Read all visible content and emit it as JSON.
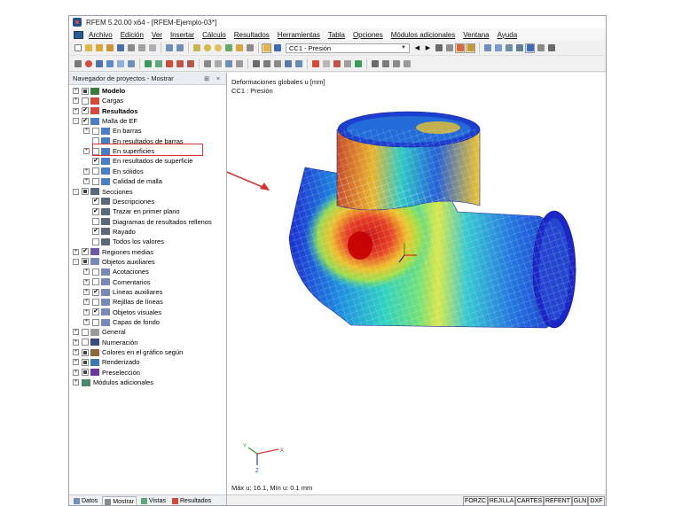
{
  "window": {
    "title": "RFEM 5.20.00 x64 - [RFEM-Ejemplo-03*]"
  },
  "menu": [
    "Archivo",
    "Edición",
    "Ver",
    "Insertar",
    "Cálculo",
    "Resultados",
    "Herramientas",
    "Tabla",
    "Opciones",
    "Módulos adicionales",
    "Ventana",
    "Ayuda"
  ],
  "toolbar": {
    "load_case": "CC1 - Presión"
  },
  "navigator": {
    "title": "Navegador de proyectos - Mostrar",
    "controls": "⊞ ×",
    "items": [
      {
        "label": "Modelo",
        "checked": "mixed",
        "expanded": "+",
        "bold": true,
        "icon": "model-icon"
      },
      {
        "label": "Cargas",
        "checked": "no",
        "expanded": "+",
        "icon": "loads-icon"
      },
      {
        "label": "Resultados",
        "checked": "yes",
        "expanded": "+",
        "bold": true,
        "icon": "results-icon"
      },
      {
        "label": "Malla de EF",
        "checked": "yes",
        "expanded": "-",
        "icon": "mesh-icon"
      },
      {
        "label": "En barras",
        "checked": "no",
        "expanded": "+",
        "icon": "mesh-icon"
      },
      {
        "label": "En resultados de barras",
        "checked": "no",
        "expanded": "",
        "icon": "mesh-icon"
      },
      {
        "label": "En superficies",
        "checked": "no",
        "expanded": "+",
        "icon": "mesh-icon"
      },
      {
        "label": "En resultados de superficie",
        "checked": "yes",
        "expanded": "",
        "icon": "mesh-icon"
      },
      {
        "label": "En sólidos",
        "checked": "no",
        "expanded": "+",
        "icon": "mesh-icon"
      },
      {
        "label": "Calidad de malla",
        "checked": "no",
        "expanded": "+",
        "icon": "mesh-icon"
      },
      {
        "label": "Secciones",
        "checked": "mixed",
        "expanded": "-",
        "icon": "sections-icon"
      },
      {
        "label": "Descripciones",
        "checked": "yes",
        "expanded": "",
        "icon": "sections-icon"
      },
      {
        "label": "Trazar en primer plano",
        "checked": "yes",
        "expanded": "",
        "icon": "sections-icon"
      },
      {
        "label": "Diagramas de resultados rellenos",
        "checked": "no",
        "expanded": "",
        "icon": "sections-icon"
      },
      {
        "label": "Rayado",
        "checked": "yes",
        "expanded": "",
        "icon": "sections-icon"
      },
      {
        "label": "Todos los valores",
        "checked": "no",
        "expanded": "",
        "icon": "sections-icon"
      },
      {
        "label": "Regiones medias",
        "checked": "yes",
        "expanded": "+",
        "icon": "regions-icon"
      },
      {
        "label": "Objetos auxiliares",
        "checked": "mixed",
        "expanded": "-",
        "icon": "aux-icon"
      },
      {
        "label": "Acotaciones",
        "checked": "no",
        "expanded": "+",
        "icon": "aux-icon"
      },
      {
        "label": "Comentarios",
        "checked": "no",
        "expanded": "+",
        "icon": "aux-icon"
      },
      {
        "label": "Líneas auxiliares",
        "checked": "yes",
        "expanded": "+",
        "icon": "aux-icon"
      },
      {
        "label": "Rejillas de líneas",
        "checked": "no",
        "expanded": "+",
        "icon": "aux-icon"
      },
      {
        "label": "Objetos visuales",
        "checked": "yes",
        "expanded": "+",
        "icon": "aux-icon"
      },
      {
        "label": "Capas de fondo",
        "checked": "no",
        "expanded": "+",
        "icon": "aux-icon"
      },
      {
        "label": "General",
        "checked": "no",
        "expanded": "+",
        "icon": "general-icon"
      },
      {
        "label": "Numeración",
        "checked": "no",
        "expanded": "+",
        "icon": "numbering-icon"
      },
      {
        "label": "Colores en el gráfico según",
        "checked": "mixed",
        "expanded": "+",
        "icon": "colors-icon"
      },
      {
        "label": "Renderizado",
        "checked": "mixed",
        "expanded": "+",
        "icon": "render-icon"
      },
      {
        "label": "Preselección",
        "checked": "mixed",
        "expanded": "+",
        "icon": "preselect-icon"
      },
      {
        "label": "Módulos adicionales",
        "checked": "",
        "expanded": "+",
        "icon": "addons-icon"
      }
    ],
    "tabs": [
      "Datos",
      "Mostrar",
      "Vistas",
      "Resultados"
    ]
  },
  "view": {
    "label1": "Deformaciones globales u [mm]",
    "label2": "CC1 : Presión",
    "max_min": "Máx u: 16.1, Mín u: 0.1 mm",
    "axes": {
      "x": "X",
      "y": "Y",
      "z": "Z"
    }
  },
  "status_buttons": [
    "FORZC",
    "REJILLA",
    "CARTES",
    "REFENT",
    "GLN",
    "DXF"
  ],
  "colors": {
    "accent": "#d33333",
    "window_bg": "#f0f0f0"
  }
}
